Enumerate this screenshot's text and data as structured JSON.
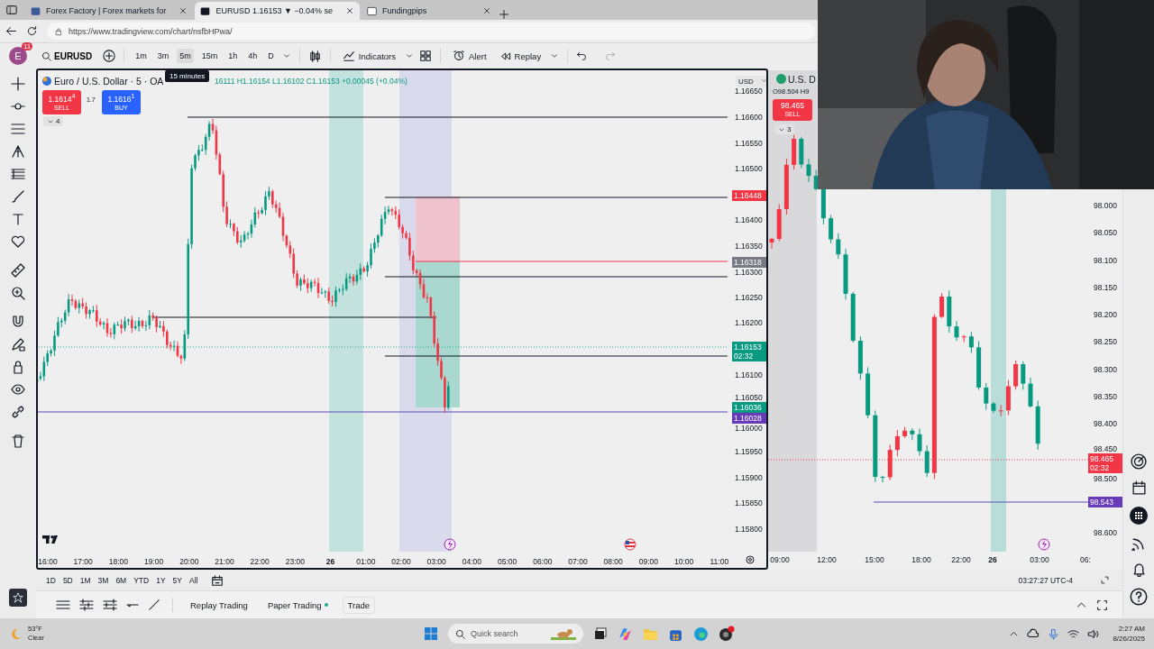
{
  "browser": {
    "tabs": [
      {
        "title": "Forex Factory | Forex markets for",
        "selected": false
      },
      {
        "title": "EURUSD 1.16153 ▼ −0.04% se",
        "selected": true
      },
      {
        "title": "Fundingpips",
        "selected": false
      }
    ],
    "url": "https://www.tradingview.com/chart/nsfbHPwa/"
  },
  "toolbar": {
    "avatar": "E",
    "notifications": "11",
    "symbol": "EURUSD",
    "intervals": [
      {
        "label": "1m",
        "selected": false
      },
      {
        "label": "3m",
        "selected": false
      },
      {
        "label": "5m",
        "selected": true
      },
      {
        "label": "15m",
        "selected": false
      },
      {
        "label": "1h",
        "selected": false
      },
      {
        "label": "4h",
        "selected": false
      },
      {
        "label": "D",
        "selected": false
      }
    ],
    "indicators": "Indicators",
    "alert": "Alert",
    "replay": "Replay",
    "tooltip": "15 minutes"
  },
  "chart_1": {
    "title": "Euro / U.S. Dollar · 5 · OA",
    "ohlc": "16111 H1.16154 L1.16102 C1.16153 +0.00045 (+0.04%)",
    "sell": {
      "price": "1.1614$^{4}$",
      "label": "SELL"
    },
    "spread": "1.7",
    "buy": {
      "price": "1.1616$^{1}$",
      "label": "BUY"
    },
    "collapsed_count": "4",
    "currency": "USD",
    "price_ticks": [
      "1.16650",
      "1.16600",
      "1.16550",
      "1.16500",
      "1.16400",
      "1.16350",
      "1.16300",
      "1.16250",
      "1.16200",
      "1.16100",
      "1.16050",
      "1.16000",
      "1.15950",
      "1.15900",
      "1.15850",
      "1.15800"
    ],
    "price_labels": [
      {
        "price": "1.16448",
        "color": "#f23645"
      },
      {
        "price": "1.16318",
        "color": "#787b86"
      },
      {
        "price": "1.16153",
        "timer": "02:32",
        "color": "#089981"
      },
      {
        "price": "1.16036",
        "color": "#089981"
      },
      {
        "price": "1.16028",
        "color": "#673ab7"
      }
    ],
    "time_ticks": [
      {
        "label": "16:00",
        "kind": "time"
      },
      {
        "label": "17:00",
        "kind": "time"
      },
      {
        "label": "18:00",
        "kind": "time"
      },
      {
        "label": "19:00",
        "kind": "time"
      },
      {
        "label": "20:00",
        "kind": "time"
      },
      {
        "label": "21:00",
        "kind": "time"
      },
      {
        "label": "22:00",
        "kind": "time"
      },
      {
        "label": "23:00",
        "kind": "time"
      },
      {
        "label": "26",
        "kind": "date"
      },
      {
        "label": "01:00",
        "kind": "time"
      },
      {
        "label": "02:00",
        "kind": "time"
      },
      {
        "label": "03:00",
        "kind": "time"
      },
      {
        "label": "04:00",
        "kind": "time"
      },
      {
        "label": "05:00",
        "kind": "time"
      },
      {
        "label": "06:00",
        "kind": "time"
      },
      {
        "label": "07:00",
        "kind": "time"
      },
      {
        "label": "08:00",
        "kind": "time"
      },
      {
        "label": "09:00",
        "kind": "time"
      },
      {
        "label": "10:00",
        "kind": "time"
      },
      {
        "label": "11:00",
        "kind": "time"
      }
    ]
  },
  "chart_2": {
    "title": "U.S. D",
    "ohlc": "O98.504 H9",
    "sell": {
      "price": "98.465",
      "label": "SELL"
    },
    "collapsed_count": "3",
    "price_ticks": [
      "98.000",
      "98.050",
      "98.100",
      "98.150",
      "98.200",
      "98.250",
      "98.300",
      "98.350",
      "98.400",
      "98.450",
      "98.500",
      "98.600"
    ],
    "price_labels": [
      {
        "price": "98.465",
        "timer": "02:32",
        "color": "#f23645"
      },
      {
        "price": "98.543",
        "color": "#673ab7"
      }
    ],
    "time_ticks": [
      {
        "label": "09:00",
        "kind": "time"
      },
      {
        "label": "12:00",
        "kind": "time"
      },
      {
        "label": "15:00",
        "kind": "time"
      },
      {
        "label": "18:00",
        "kind": "time"
      },
      {
        "label": "22:00",
        "kind": "time"
      },
      {
        "label": "26",
        "kind": "date"
      },
      {
        "label": "03:00",
        "kind": "time"
      },
      {
        "label": "06:",
        "kind": "time"
      }
    ]
  },
  "bottom_bar": {
    "periods": [
      "1D",
      "5D",
      "1M",
      "3M",
      "6M",
      "YTD",
      "1Y",
      "5Y",
      "All"
    ],
    "clock": "03:27:27 UTC-4"
  },
  "panel": {
    "tabs": [
      {
        "label": "Replay Trading",
        "connected": false,
        "kind": "tab"
      },
      {
        "label": "Paper Trading",
        "connected": true,
        "kind": "tab"
      },
      {
        "label": "Trade",
        "connected": false,
        "kind": "button"
      }
    ]
  },
  "taskbar": {
    "weather": {
      "temperature": "53°F",
      "condition": "Clear"
    },
    "search_placeholder": "Quick search",
    "time": "2:27 AM",
    "date": "8/26/2025"
  }
}
